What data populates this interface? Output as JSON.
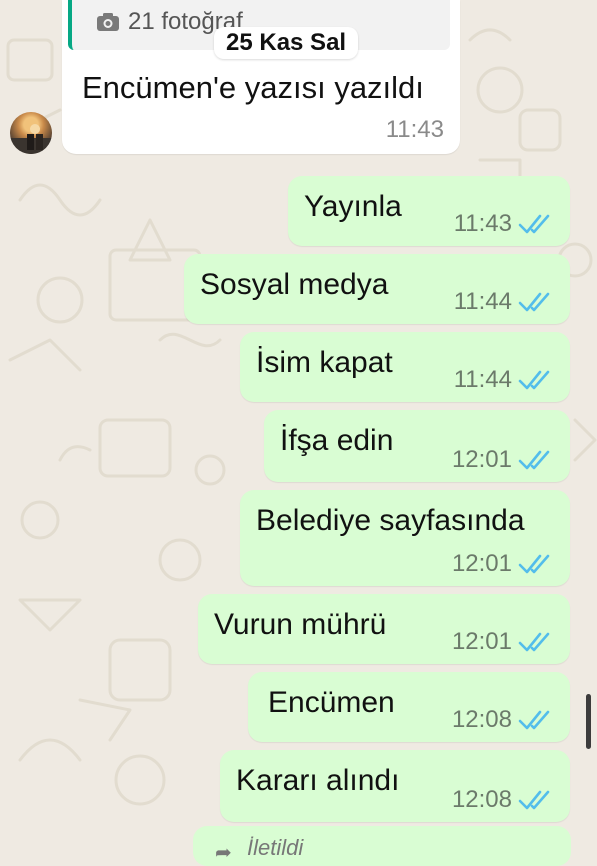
{
  "chat": {
    "date_chip": "25 Kas Sal",
    "incoming": {
      "quote_text": "21 fotoğraf",
      "text": "Encümen'e yazısı yazıldı",
      "time": "11:43"
    },
    "outgoing": [
      {
        "text": "Yayınla",
        "time": "11:43"
      },
      {
        "text": "Sosyal medya",
        "time": "11:44"
      },
      {
        "text": "İsim kapat",
        "time": "11:44"
      },
      {
        "text": "İfşa edin",
        "time": "12:01"
      },
      {
        "text": "Belediye sayfasında",
        "time": "12:01"
      },
      {
        "text": "Vurun mührü",
        "time": "12:01"
      },
      {
        "text": "Encümen",
        "time": "12:08"
      },
      {
        "text": "Kararı alındı",
        "time": "12:08"
      }
    ],
    "forwarded_label": "İletildi"
  },
  "colors": {
    "background": "#efeae2",
    "outgoing_bubble": "#d9fdd3",
    "incoming_bubble": "#ffffff",
    "read_tick": "#53bdeb",
    "quote_bar": "#06a884"
  },
  "icons": {
    "quote": "camera-icon",
    "status": "double-check-icon",
    "forward": "forward-arrow-icon"
  }
}
